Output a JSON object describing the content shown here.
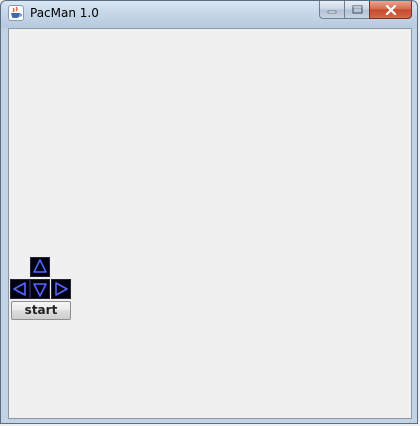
{
  "window": {
    "title": "PacMan 1.0",
    "icon": "java-cup-icon",
    "controls": [
      "minimize-icon",
      "maximize-icon",
      "close-icon"
    ]
  },
  "controls_pad": {
    "keys": [
      "arrow-up-icon",
      "arrow-left-icon",
      "arrow-down-icon",
      "arrow-right-icon"
    ],
    "key_color": "#000010",
    "arrow_color": "#5566ff",
    "start_label": "start"
  },
  "colors": {
    "client_background": "#f0f0f0",
    "close_button": "#c44a2b"
  }
}
